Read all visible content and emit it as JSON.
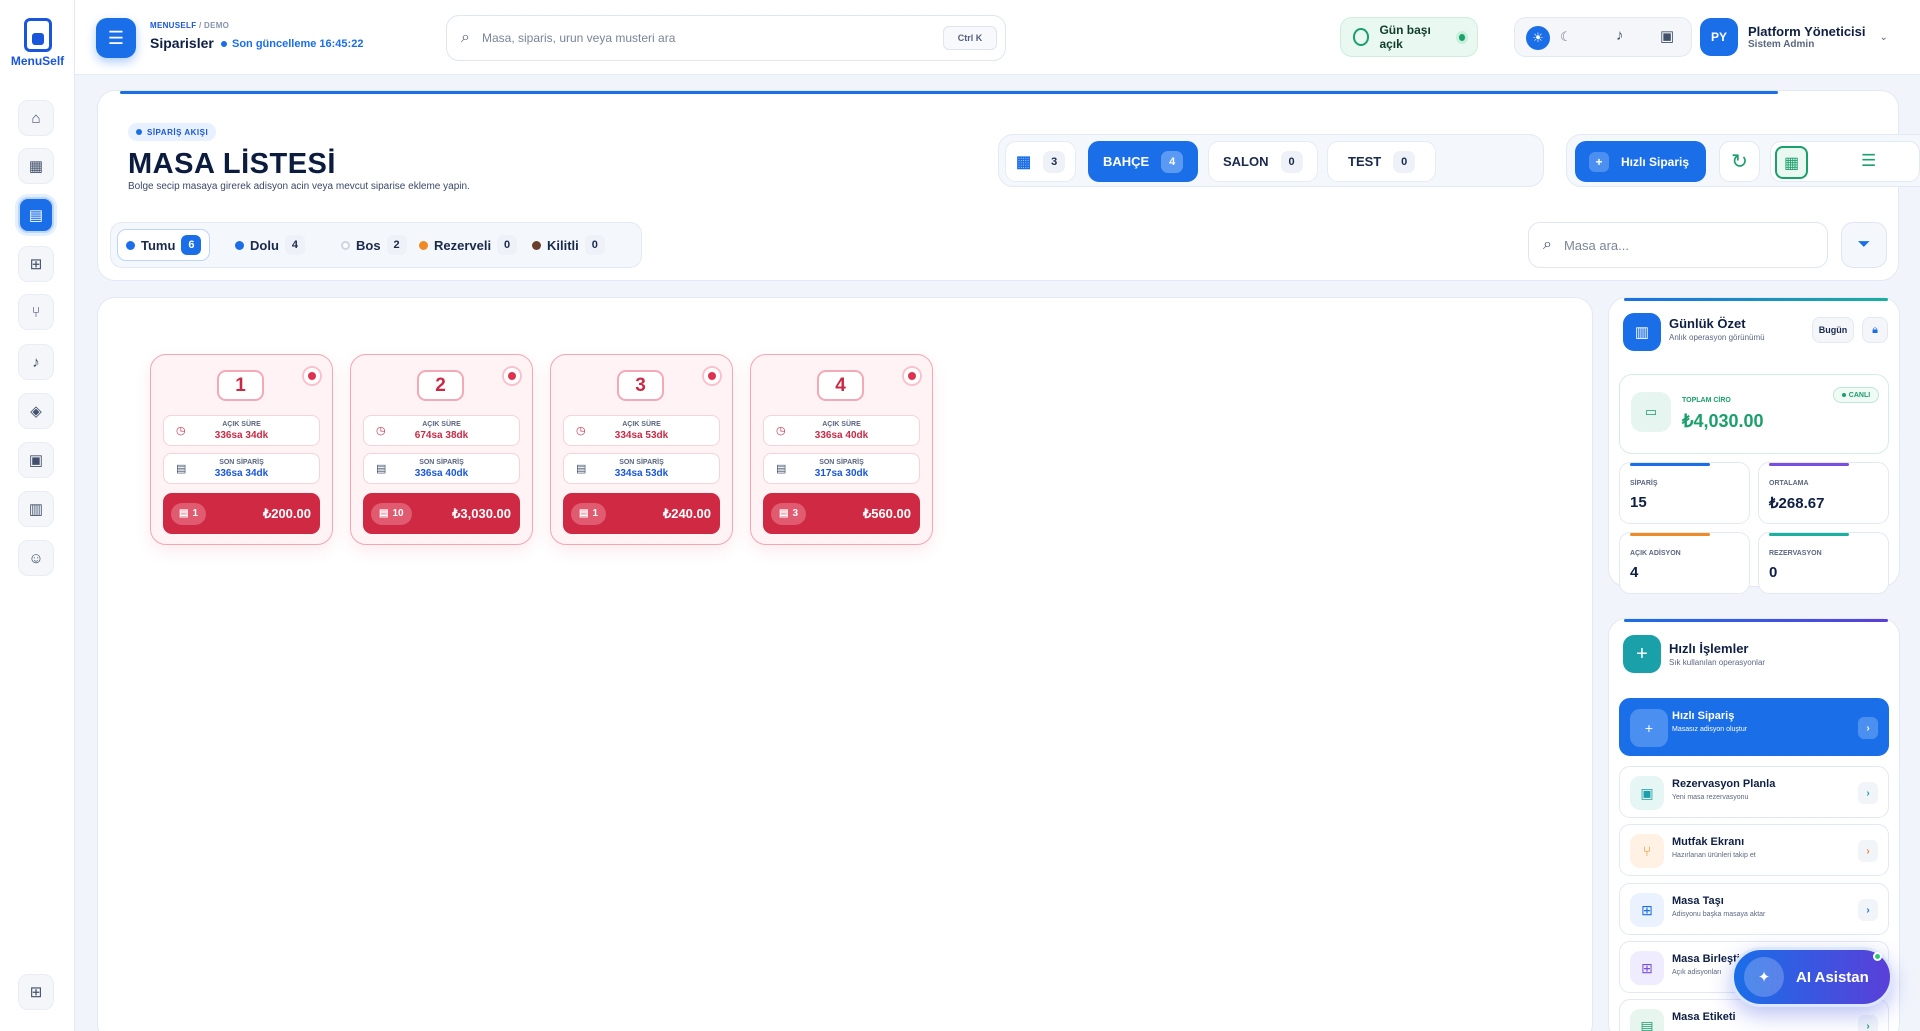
{
  "brand": {
    "name": "MenuSelf"
  },
  "header": {
    "crumb_root": "MENUSELF",
    "crumb_sep": "/",
    "crumb_leaf": "DEMO",
    "title": "Siparisler",
    "updated": "Son güncelleme 16:45:22",
    "search_placeholder": "Masa, siparis, urun veya musteri ara",
    "search_shortcut": "Ctrl K",
    "day_status": "Gün başı açık",
    "user_initials": "PY",
    "user_name": "Platform Yöneticisi",
    "user_role": "Sistem Admin"
  },
  "sidebar": {
    "items": [
      {
        "icon": "home-icon",
        "glyph": "⌂"
      },
      {
        "icon": "dashboard-icon",
        "glyph": "▦"
      },
      {
        "icon": "orders-icon",
        "glyph": "▤"
      },
      {
        "icon": "widgets-icon",
        "glyph": "⊞"
      },
      {
        "icon": "cutlery-icon",
        "glyph": "⑂"
      },
      {
        "icon": "bell-icon",
        "glyph": "♪"
      },
      {
        "icon": "layers-icon",
        "glyph": "◈"
      },
      {
        "icon": "calendar-icon",
        "glyph": "▣"
      },
      {
        "icon": "chart-icon",
        "glyph": "▥"
      },
      {
        "icon": "users-icon",
        "glyph": "☺"
      }
    ],
    "bottom": {
      "icon": "apps-icon",
      "glyph": "⊞"
    }
  },
  "flow": {
    "badge": "SİPARİŞ AKIŞI",
    "title": "MASA LİSTESİ",
    "subtitle": "Bolge secip masaya girerek adisyon acin veya mevcut siparise ekleme yapin."
  },
  "zones": [
    {
      "label": "",
      "count": "3"
    },
    {
      "label": "BAHÇE",
      "count": "4"
    },
    {
      "label": "SALON",
      "count": "0"
    },
    {
      "label": "TEST",
      "count": "0"
    }
  ],
  "actions": {
    "quick_order": "Hızlı Sipariş"
  },
  "filters": [
    {
      "label": "Tumu",
      "count": "6",
      "color": "#1a6ee8"
    },
    {
      "label": "Dolu",
      "count": "4",
      "color": "#1a6ee8"
    },
    {
      "label": "Bos",
      "count": "2",
      "color": "#ffffff"
    },
    {
      "label": "Rezerveli",
      "count": "0",
      "color": "#f08a24"
    },
    {
      "label": "Kilitli",
      "count": "0",
      "color": "#6b3f2a"
    }
  ],
  "table_search_placeholder": "Masa ara...",
  "tables": [
    {
      "number": "1",
      "open_label": "AÇIK SÜRE",
      "open_value": "336sa 34dk",
      "last_label": "SON SİPARİŞ",
      "last_value": "336sa 34dk",
      "items": "1",
      "amount": "₺200.00"
    },
    {
      "number": "2",
      "open_label": "AÇIK SÜRE",
      "open_value": "674sa 38dk",
      "last_label": "SON SİPARİŞ",
      "last_value": "336sa 40dk",
      "items": "10",
      "amount": "₺3,030.00"
    },
    {
      "number": "3",
      "open_label": "AÇIK SÜRE",
      "open_value": "334sa 53dk",
      "last_label": "SON SİPARİŞ",
      "last_value": "334sa 53dk",
      "items": "1",
      "amount": "₺240.00"
    },
    {
      "number": "4",
      "open_label": "AÇIK SÜRE",
      "open_value": "336sa 40dk",
      "last_label": "SON SİPARİŞ",
      "last_value": "317sa 30dk",
      "items": "3",
      "amount": "₺560.00"
    }
  ],
  "summary": {
    "title": "Günlük Özet",
    "subtitle": "Anlık operasyon görünümü",
    "today": "Bugün",
    "revenue_label": "TOPLAM CİRO",
    "revenue_value": "₺4,030.00",
    "live": "CANLI",
    "stats": [
      {
        "label": "SİPARİŞ",
        "value": "15",
        "color": "#1a6ee8"
      },
      {
        "label": "ORTALAMA",
        "value": "₺268.67",
        "color": "#7a4ee0"
      },
      {
        "label": "AÇIK ADİSYON",
        "value": "4",
        "color": "#f08a24"
      },
      {
        "label": "REZERVASYON",
        "value": "0",
        "color": "#1ab0a0"
      }
    ]
  },
  "quick_actions": {
    "title": "Hızlı İşlemler",
    "subtitle": "Sık kullanılan operasyonlar",
    "items": [
      {
        "title": "Hızlı Sipariş",
        "sub": "Masasız adisyon oluştur",
        "icon": "plus-icon",
        "glyph": "+",
        "bg": "#4b8ff0",
        "fg": "#ffffff"
      },
      {
        "title": "Rezervasyon Planla",
        "sub": "Yeni masa rezervasyonu",
        "icon": "calendar-icon",
        "glyph": "▣",
        "bg": "#e6f6f5",
        "fg": "#1aa0a8"
      },
      {
        "title": "Mutfak Ekranı",
        "sub": "Hazırlanan ürünleri takip et",
        "icon": "cutlery-icon",
        "glyph": "⑂",
        "bg": "#fff1e4",
        "fg": "#f08a24"
      },
      {
        "title": "Masa Taşı",
        "sub": "Adisyonu başka masaya aktar",
        "icon": "move-icon",
        "glyph": "⊞",
        "bg": "#eaf2ff",
        "fg": "#1a6ee8"
      },
      {
        "title": "Masa Birleştir",
        "sub": "Açık adisyonları",
        "icon": "merge-icon",
        "glyph": "⊞",
        "bg": "#f0ecff",
        "fg": "#7a4ee0"
      },
      {
        "title": "Masa Etiketi",
        "sub": "",
        "icon": "label-icon",
        "glyph": "▤",
        "bg": "#e6f6ef",
        "fg": "#1aa06b"
      }
    ]
  },
  "ai": {
    "label": "AI Asistan"
  }
}
